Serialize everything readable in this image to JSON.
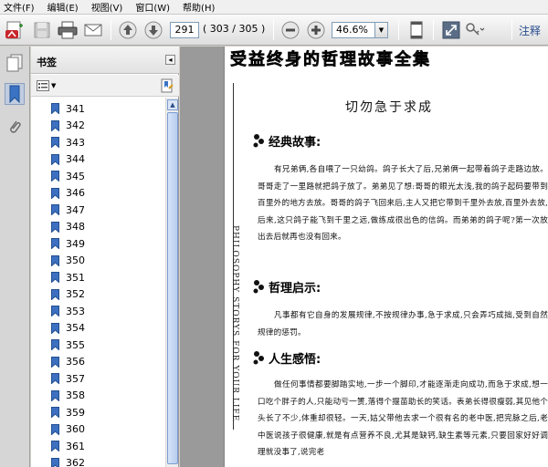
{
  "menubar": {
    "items": [
      "文件(F)",
      "编辑(E)",
      "视图(V)",
      "窗口(W)",
      "帮助(H)"
    ]
  },
  "toolbar": {
    "current_page": "291",
    "page_count": "( 303 / 305 )",
    "zoom": "46.6%",
    "annotate_label": "注释"
  },
  "bookmarks_panel": {
    "title": "书签",
    "items": [
      "341",
      "342",
      "343",
      "344",
      "345",
      "346",
      "347",
      "348",
      "349",
      "350",
      "351",
      "352",
      "353",
      "354",
      "355",
      "356",
      "357",
      "358",
      "359",
      "360",
      "361",
      "362"
    ]
  },
  "document": {
    "book_title": "受益终身的哲理故事全集",
    "spine_text": "PHILOSOPHY STORYS FOR YOUR LIFE",
    "chapter_title": "切勿急于求成",
    "section1": "经典故事:",
    "para1": "有兄弟俩,各自喂了一只幼鸽。鸽子长大了后,兄弟俩一起带着鸽子走路边放。哥哥走了一里路就把鸽子放了。弟弟见了想:哥哥的眼光太浅,我的鸽子起码要带到百里外的地方去放。哥哥的鸽子飞回来后,主人又把它带到千里外去放,百里外去放,后来,这只鸽子能飞到千里之远,做练成很出色的信鸽。而弟弟的鸽子呢?第一次放出去后就再也没有回来。",
    "section2": "哲理启示:",
    "para2": "凡事都有它自身的发展规律,不按规律办事,急于求成,只会弄巧成拙,受到自然规律的惩罚。",
    "section3": "人生感悟:",
    "para3": "做任何事情都要脚踏实地,一步一个脚印,才能逐渐走向成功,而急于求成,想一口吃个胖子的人,只能动亏一箦,落得个揠苗助长的笑话。表弟长得很瘦弱,其见他个头长了不少,体重却很轻。一天,姑父带他去求一个很有名的老中医,把完脉之后,老中医说孩子很健康,就是有点营养不良,尤其是缺钙,缺生素等元素,只要回家好好调理就没事了,说完老"
  }
}
